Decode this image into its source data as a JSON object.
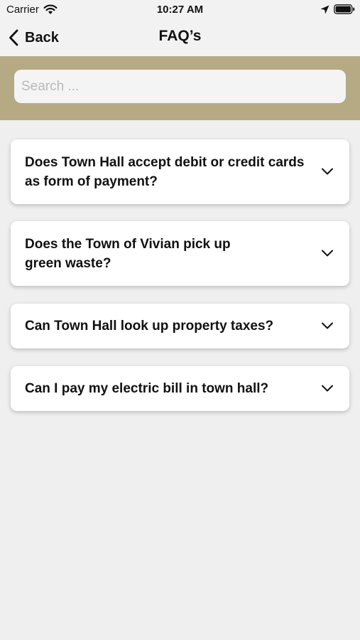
{
  "status_bar": {
    "carrier": "Carrier",
    "time": "10:27 AM"
  },
  "nav": {
    "back_label": "Back",
    "title": "FAQ’s"
  },
  "search": {
    "placeholder": "Search ...",
    "value": ""
  },
  "faqs": [
    {
      "question": "Does Town Hall accept debit or credit cards as form of payment?"
    },
    {
      "question": "Does the Town of Vivian pick up green waste?"
    },
    {
      "question": "Can Town Hall look up property taxes?"
    },
    {
      "question": "Can I pay my electric bill in town hall?"
    }
  ],
  "colors": {
    "search_band": "#b6aa84",
    "background": "#efefef",
    "card": "#ffffff"
  },
  "icons": {
    "wifi": "wifi-icon",
    "location": "location-arrow-icon",
    "battery": "battery-icon",
    "back": "chevron-left-icon",
    "expand": "chevron-down-icon"
  }
}
